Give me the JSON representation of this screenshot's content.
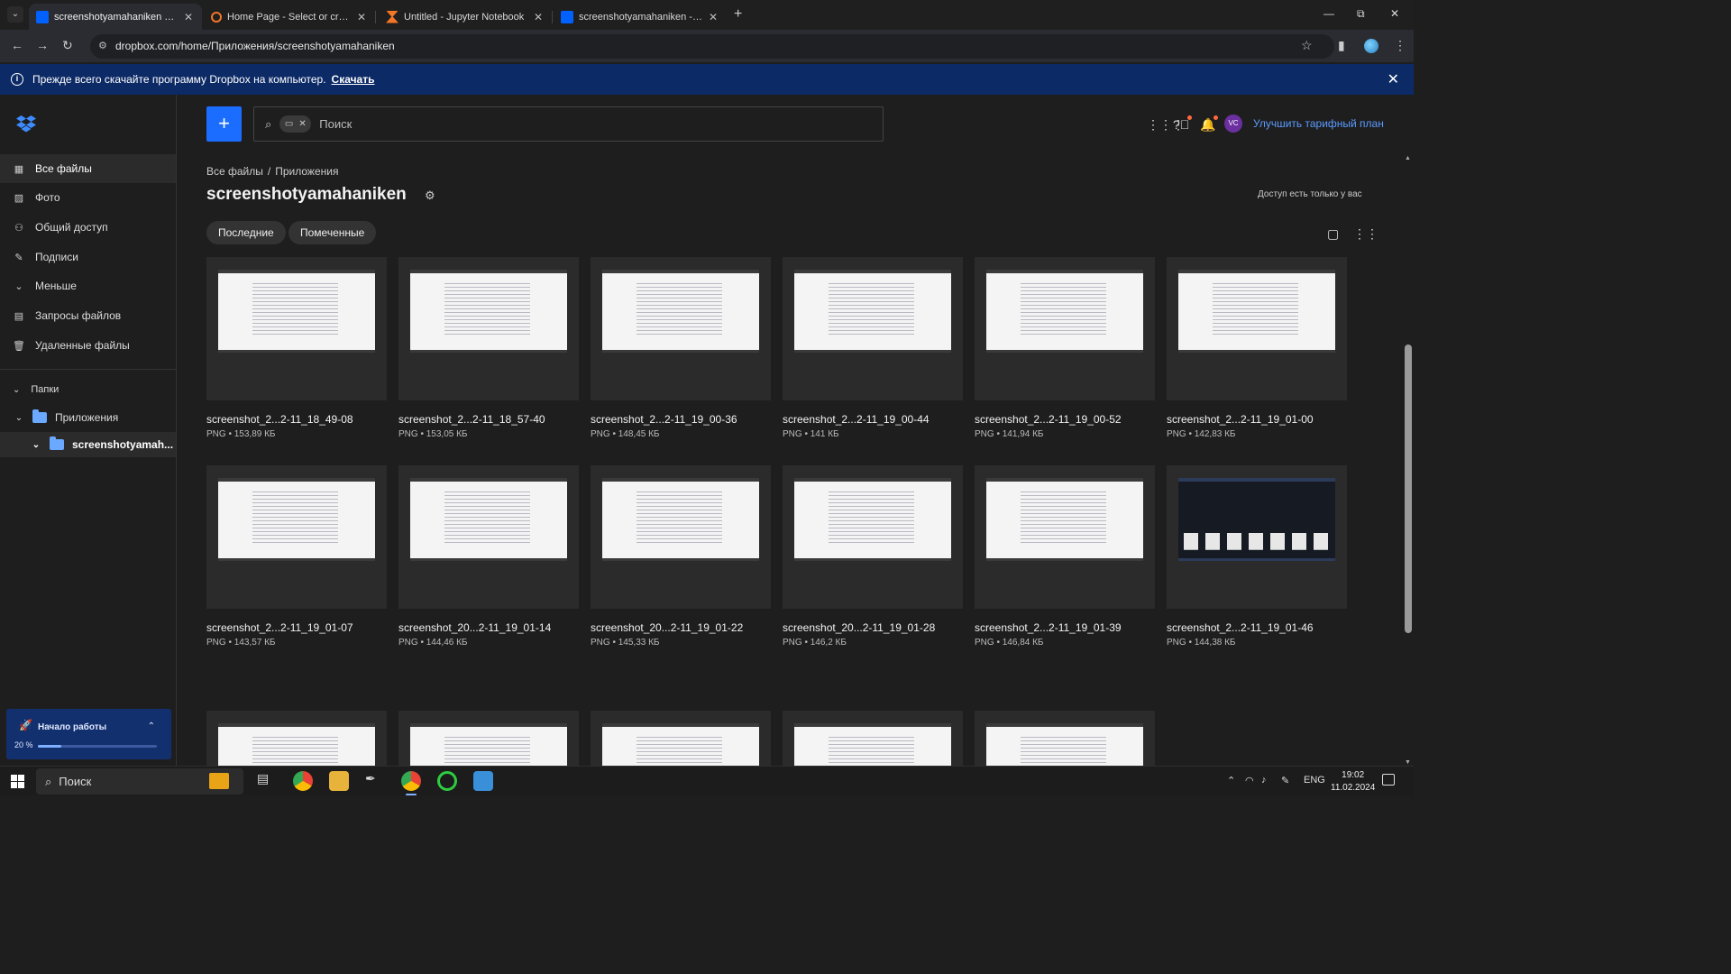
{
  "browser": {
    "tabs": [
      {
        "title": "screenshotyamahaniken — Dropbox",
        "favicon": "dropbox",
        "active": true
      },
      {
        "title": "Home Page - Select or create a notebook",
        "favicon": "jupyter",
        "active": false
      },
      {
        "title": "Untitled - Jupyter Notebook",
        "favicon": "jupyter-hourglass",
        "active": false
      },
      {
        "title": "screenshotyamahaniken - Dropbox",
        "favicon": "dropbox",
        "active": false
      }
    ],
    "url": "dropbox.com/home/Приложения/screenshotyamahaniken"
  },
  "banner": {
    "message": "Прежде всего скачайте программу Dropbox на компьютер.",
    "link": "Скачать"
  },
  "sidebar": {
    "nav": [
      {
        "label": "Все файлы",
        "icon": "all-files-icon",
        "active": true
      },
      {
        "label": "Фото",
        "icon": "photo-icon",
        "active": false
      },
      {
        "label": "Общий доступ",
        "icon": "shared-icon",
        "active": false
      },
      {
        "label": "Подписи",
        "icon": "signature-icon",
        "active": false
      },
      {
        "label": "Меньше",
        "icon": "chevron-down-icon",
        "active": false
      },
      {
        "label": "Запросы файлов",
        "icon": "file-request-icon",
        "active": false
      },
      {
        "label": "Удаленные файлы",
        "icon": "trash-icon",
        "active": false
      }
    ],
    "folders_heading": "Папки",
    "tree": [
      {
        "label": "Приложения"
      },
      {
        "label": "screenshotyamah..."
      }
    ],
    "getting_started": {
      "label": "Начало работы",
      "percent_text": "20 %",
      "progress": 0.2
    }
  },
  "topbar": {
    "search_placeholder": "Поиск",
    "upgrade": "Улучшить тарифный план",
    "avatar_initials": "VC"
  },
  "breadcrumb": {
    "root": "Все файлы",
    "sep": "/",
    "parent": "Приложения"
  },
  "folder": {
    "title": "screenshotyamahaniken",
    "access_note": "Доступ есть только у вас",
    "filters": [
      "Последние",
      "Помеченные"
    ]
  },
  "files": [
    {
      "name": "screenshot_2...2-11_18_49-08",
      "meta": "PNG • 153,89 КБ",
      "preview": "light"
    },
    {
      "name": "screenshot_2...2-11_18_57-40",
      "meta": "PNG • 153,05 КБ",
      "preview": "light"
    },
    {
      "name": "screenshot_2...2-11_19_00-36",
      "meta": "PNG • 148,45 КБ",
      "preview": "light"
    },
    {
      "name": "screenshot_2...2-11_19_00-44",
      "meta": "PNG • 141 КБ",
      "preview": "light"
    },
    {
      "name": "screenshot_2...2-11_19_00-52",
      "meta": "PNG • 141,94 КБ",
      "preview": "light"
    },
    {
      "name": "screenshot_2...2-11_19_01-00",
      "meta": "PNG • 142,83 КБ",
      "preview": "light"
    },
    {
      "name": "screenshot_2...2-11_19_01-07",
      "meta": "PNG • 143,57 КБ",
      "preview": "light"
    },
    {
      "name": "screenshot_20...2-11_19_01-14",
      "meta": "PNG • 144,46 КБ",
      "preview": "light"
    },
    {
      "name": "screenshot_20...2-11_19_01-22",
      "meta": "PNG • 145,33 КБ",
      "preview": "light"
    },
    {
      "name": "screenshot_20...2-11_19_01-28",
      "meta": "PNG • 146,2 КБ",
      "preview": "light"
    },
    {
      "name": "screenshot_2...2-11_19_01-39",
      "meta": "PNG • 146,84 КБ",
      "preview": "light"
    },
    {
      "name": "screenshot_2...2-11_19_01-46",
      "meta": "PNG • 144,38 КБ",
      "preview": "dark"
    },
    {
      "name": "",
      "meta": "",
      "preview": "light"
    },
    {
      "name": "",
      "meta": "",
      "preview": "light"
    },
    {
      "name": "",
      "meta": "",
      "preview": "light"
    },
    {
      "name": "",
      "meta": "",
      "preview": "light"
    },
    {
      "name": "",
      "meta": "",
      "preview": "light"
    }
  ],
  "taskbar": {
    "search_placeholder": "Поиск",
    "lang": "ENG",
    "time": "19:02",
    "date": "11.02.2024"
  },
  "colors": {
    "accent": "#1a6dff",
    "banner": "#0c2a66",
    "link": "#5a9bff"
  }
}
